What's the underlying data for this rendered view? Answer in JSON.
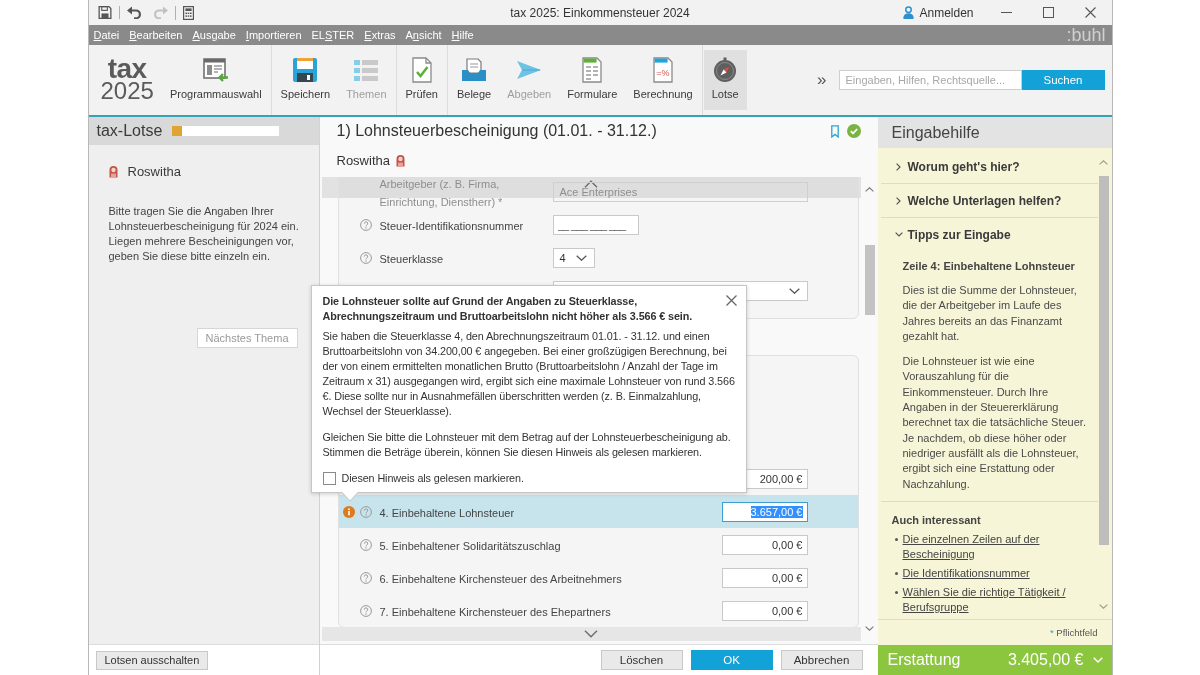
{
  "title_bar": {
    "quick_access": [
      [
        {
          "kind": "save",
          "disabled": false
        }
      ],
      [
        {
          "kind": "undo",
          "disabled": false
        },
        {
          "kind": "redo",
          "disabled": true
        }
      ],
      [
        {
          "kind": "calculator",
          "disabled": false
        }
      ]
    ],
    "title": "tax 2025: Einkommensteuer 2024",
    "account": "Anmelden"
  },
  "menu_bar": {
    "items": [
      {
        "key": "D",
        "post": "atei"
      },
      {
        "key": "B",
        "post": "earbeiten"
      },
      {
        "key": "A",
        "post": "usgabe"
      },
      {
        "key": "I",
        "post": "mportieren"
      },
      {
        "pre": "EL",
        "key": "S",
        "post": "TER"
      },
      {
        "key": "E",
        "post": "xtras"
      },
      {
        "pre": "A",
        "key": "n",
        "post": "sicht"
      },
      {
        "key": "H",
        "post": "ilfe"
      }
    ],
    "brand": ":buhl"
  },
  "toolbar": {
    "logo": {
      "word": "tax",
      "year": "2025"
    },
    "groups": [
      [
        {
          "kind": "program",
          "label": "Programmauswahl",
          "disabled": false,
          "selected": false
        }
      ],
      [
        {
          "kind": "save",
          "label": "Speichern",
          "disabled": false,
          "selected": false
        },
        {
          "kind": "topics",
          "label": "Themen",
          "disabled": true,
          "selected": false
        }
      ],
      [
        {
          "kind": "check",
          "label": "Prüfen",
          "disabled": false,
          "selected": false
        }
      ],
      [
        {
          "kind": "receipts",
          "label": "Belege",
          "disabled": false,
          "selected": false
        },
        {
          "kind": "submit",
          "label": "Abgeben",
          "disabled": true,
          "selected": false
        },
        {
          "kind": "forms",
          "label": "Formulare",
          "disabled": false,
          "selected": false
        },
        {
          "kind": "calculation",
          "label": "Berechnung",
          "icon_text": "=%",
          "disabled": false,
          "selected": false
        }
      ],
      [
        {
          "kind": "guide",
          "label": "Lotse",
          "disabled": false,
          "selected": true
        }
      ]
    ],
    "expand": "»",
    "search": {
      "placeholder": "Eingaben, Hilfen, Rechtsquelle...",
      "button": "Suchen"
    }
  },
  "guide_panel": {
    "title": "tax-Lotse",
    "progress": {
      "level": 0.09
    },
    "person": "Roswitha",
    "instructions": "Bitte tragen Sie die Angaben Ihrer Lohnsteuerbescheinigung für 2024 ein. Liegen mehrere Bescheinigungen vor, geben Sie diese bitte einzeln ein.",
    "next_button": {
      "label": "Nächstes Thema",
      "disabled": true
    },
    "footer_button": "Lotsen ausschalten"
  },
  "form": {
    "title": "1) Lohnsteuerbescheinigung (01.01. - 31.12.)",
    "person": "Roswitha",
    "cards": [
      {
        "rows": [
          {
            "kind": "text",
            "label": "Arbeitgeber (z. B. Firma, Einrichtung, Dienstherr) *",
            "value": "Ace Enterprises",
            "wide": true,
            "help": false,
            "warning": false,
            "dimmed": true,
            "selected": false
          },
          {
            "kind": "text",
            "label": "Steuer-Identifikationsnummer",
            "placeholder": "__ ___ ___ ___",
            "wide": false,
            "help": true,
            "warning": false,
            "dimmed": false,
            "selected": false
          },
          {
            "kind": "select",
            "label": "Steuerklasse",
            "value": "4",
            "wide": false,
            "help": true,
            "warning": false,
            "dimmed": false,
            "selected": false
          },
          {
            "kind": "select",
            "wide": true,
            "help": false,
            "warning": false,
            "dimmed": false,
            "selected": false
          }
        ]
      },
      {
        "rows": [
          {
            "kind": "amount",
            "value": "200,00 €",
            "help": false,
            "warning": false,
            "dimmed": false,
            "selected": false
          },
          {
            "kind": "amount",
            "label": "4. Einbehaltene Lohnsteuer",
            "value": "3.657,00 €",
            "help": true,
            "warning": true,
            "dimmed": false,
            "selected": true
          },
          {
            "kind": "amount",
            "label": "5. Einbehaltener Solidaritätszuschlag",
            "value": "0,00 €",
            "help": true,
            "warning": false,
            "dimmed": false,
            "selected": false
          },
          {
            "kind": "amount",
            "label": "6. Einbehaltene Kirchensteuer des Arbeitnehmers",
            "value": "0,00 €",
            "help": true,
            "warning": false,
            "dimmed": false,
            "selected": false
          },
          {
            "kind": "amount",
            "label": "7. Einbehaltene Kirchensteuer des Ehepartners",
            "value": "0,00 €",
            "help": true,
            "warning": false,
            "dimmed": false,
            "selected": false
          }
        ]
      }
    ]
  },
  "hint": {
    "title": "Die Lohnsteuer sollte auf Grund der Angaben zu Steuerklasse, Abrechnungszeitraum und Bruttoarbeitslohn nicht höher als 3.566 € sein.",
    "paragraphs": [
      "Sie haben die Steuerklasse 4, den Abrechnungszeitraum 01.01. - 31.12. und einen Bruttoarbeitslohn von 34.200,00 € angegeben. Bei einer großzügigen Berechnung, bei der von einem ermittelten monatlichen Brutto (Bruttoarbeitslohn / Anzahl der Tage im Zeitraum x 31) ausgegangen wird, ergibt sich eine maximale Lohnsteuer von rund 3.566 €. Diese sollte nur in Ausnahmefällen überschritten werden (z. B. Einmalzahlung, Wechsel der Steuerklasse).",
      "Gleichen Sie bitte die Lohnsteuer mit dem Betrag auf der Lohnsteuerbescheinigung ab. Stimmen die Beträge überein, können Sie diesen Hinweis als gelesen markieren."
    ],
    "checkbox": {
      "label": "Diesen Hinweis als gelesen markieren.",
      "checked": false
    }
  },
  "help_panel": {
    "title": "Eingabehilfe",
    "sections": [
      {
        "title": "Worum geht's hier?",
        "expanded": false
      },
      {
        "title": "Welche Unterlagen helfen?",
        "expanded": false
      },
      {
        "title": "Tipps zur Eingabe",
        "expanded": true,
        "heading": "Zeile 4: Einbehaltene Lohnsteuer",
        "paragraphs": [
          "Dies ist die Summe der Lohnsteuer, die der Arbeitgeber im Laufe des Jahres bereits an das Finanzamt gezahlt hat.",
          "Die Lohnsteuer ist wie eine Vorauszahlung für die Einkommensteuer. Durch Ihre Angaben in der Steuererklärung berechnet tax die tatsächliche Steuer. Je nachdem, ob diese höher oder niedriger ausfällt als die Lohnsteuer, ergibt sich eine Erstattung oder Nachzahlung."
        ]
      }
    ],
    "related": {
      "title": "Auch interessant",
      "links": [
        "Die einzelnen Zeilen auf der Bescheinigung",
        "Die Identifikationsnummer",
        "Wählen Sie die richtige Tätigkeit / Berufsgruppe"
      ]
    },
    "required_note": {
      "mark": "*",
      "label": "Pflichtfeld"
    }
  },
  "footer": {
    "buttons": [
      {
        "label": "Löschen",
        "primary": false
      },
      {
        "label": "OK",
        "primary": true
      },
      {
        "label": "Abbrechen",
        "primary": false
      }
    ],
    "result": {
      "label": "Erstattung",
      "amount": "3.405,00 €"
    }
  }
}
